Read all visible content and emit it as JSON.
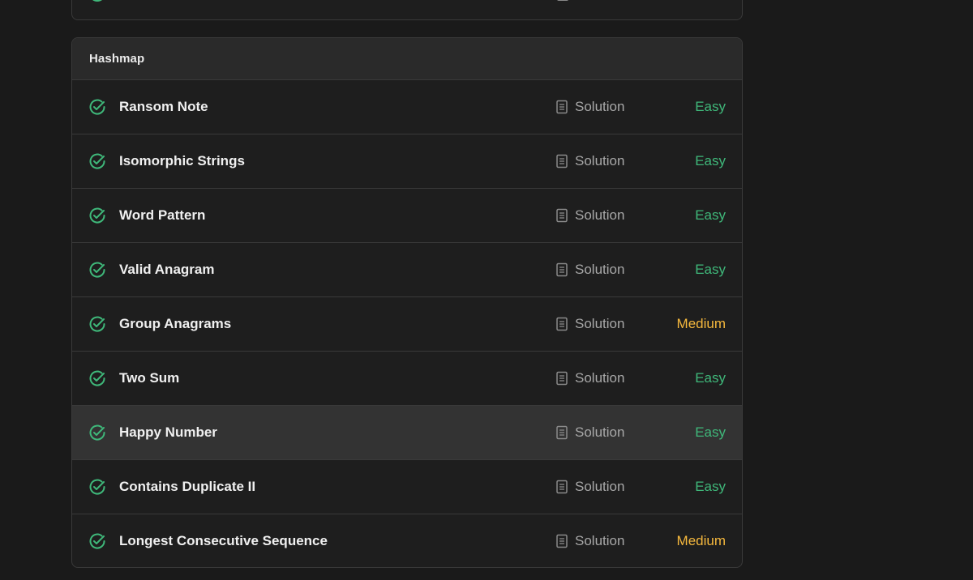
{
  "colors": {
    "background": "#1a1a1a",
    "card": "#1e1e1e",
    "header": "#2a2a2a",
    "highlight_row": "#333333",
    "easy": "#3fb87a",
    "medium": "#f5b83d",
    "check": "#3fb87a"
  },
  "section": {
    "title": "Hashmap",
    "problems": [
      {
        "title": "Ransom Note",
        "solution_label": "Solution",
        "difficulty": "Easy",
        "status_icon": "check-circle-icon",
        "solution_icon": "document-icon"
      },
      {
        "title": "Isomorphic Strings",
        "solution_label": "Solution",
        "difficulty": "Easy",
        "status_icon": "check-circle-icon",
        "solution_icon": "document-icon"
      },
      {
        "title": "Word Pattern",
        "solution_label": "Solution",
        "difficulty": "Easy",
        "status_icon": "check-circle-icon",
        "solution_icon": "document-icon"
      },
      {
        "title": "Valid Anagram",
        "solution_label": "Solution",
        "difficulty": "Easy",
        "status_icon": "check-circle-icon",
        "solution_icon": "document-icon"
      },
      {
        "title": "Group Anagrams",
        "solution_label": "Solution",
        "difficulty": "Medium",
        "status_icon": "check-circle-icon",
        "solution_icon": "document-icon"
      },
      {
        "title": "Two Sum",
        "solution_label": "Solution",
        "difficulty": "Easy",
        "status_icon": "check-circle-icon",
        "solution_icon": "document-icon"
      },
      {
        "title": "Happy Number",
        "solution_label": "Solution",
        "difficulty": "Easy",
        "status_icon": "check-circle-icon",
        "solution_icon": "document-icon",
        "hovered": true
      },
      {
        "title": "Contains Duplicate II",
        "solution_label": "Solution",
        "difficulty": "Easy",
        "status_icon": "check-circle-icon",
        "solution_icon": "document-icon"
      },
      {
        "title": "Longest Consecutive Sequence",
        "solution_label": "Solution",
        "difficulty": "Medium",
        "status_icon": "check-circle-icon",
        "solution_icon": "document-icon"
      }
    ]
  }
}
